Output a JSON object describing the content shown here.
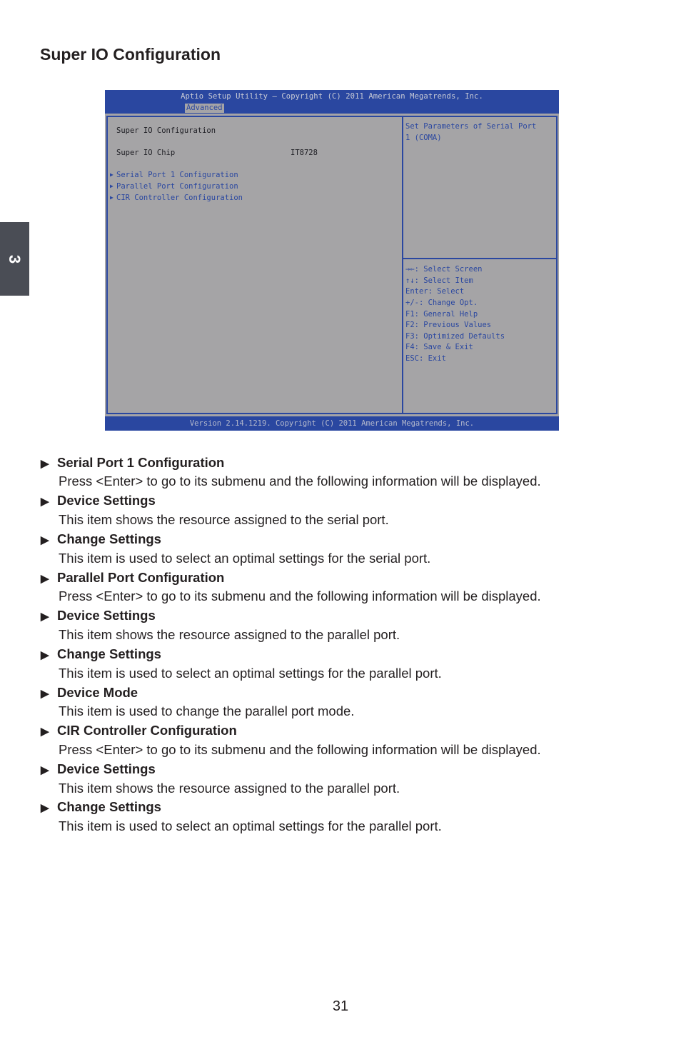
{
  "chapter_tab": "3",
  "page_title": "Super IO Configuration",
  "bios": {
    "header_title": "Aptio Setup Utility – Copyright (C) 2011 American Megatrends, Inc.",
    "active_tab": "Advanced",
    "left_panel": {
      "heading": "Super IO Configuration",
      "chip_label": "Super IO Chip",
      "chip_value": "IT8728",
      "submenus": [
        "Serial Port 1 Configuration",
        "Parallel Port Configuration",
        "CIR Controller Configuration"
      ],
      "submenu_marker": "▶"
    },
    "help_text": [
      "Set Parameters of Serial Port",
      "1 (COMA)"
    ],
    "key_help": [
      "→←: Select Screen",
      "↑↓: Select Item",
      "Enter: Select",
      "+/-: Change Opt.",
      "F1: General Help",
      "F2: Previous Values",
      "F3: Optimized Defaults",
      "F4: Save & Exit",
      "ESC: Exit"
    ],
    "footer": "Version 2.14.1219. Copyright (C) 2011 American Megatrends, Inc."
  },
  "descriptions": [
    {
      "title": "Serial Port 1 Configuration",
      "text": "Press <Enter> to go to its submenu and the following information will be displayed."
    },
    {
      "title": "Device Settings",
      "text": "This item shows the resource assigned to the serial port."
    },
    {
      "title": "Change Settings",
      "text": "This item is used to select an optimal settings for the serial port."
    },
    {
      "title": "Parallel Port Configuration",
      "text": "Press <Enter> to go to its submenu and the following information will be displayed."
    },
    {
      "title": "Device Settings",
      "text": "This item shows the resource assigned to the parallel port."
    },
    {
      "title": "Change Settings",
      "text": "This item is used to select an optimal settings for the parallel port."
    },
    {
      "title": "Device Mode",
      "text": "This item is used to change the parallel port mode."
    },
    {
      "title": "CIR Controller Configuration",
      "text": "Press <Enter> to go to its submenu and the following information will be displayed."
    },
    {
      "title": "Device Settings",
      "text": "This item shows the resource assigned to the parallel port."
    },
    {
      "title": "Change Settings",
      "text": "This item is used to select an optimal settings for the parallel port."
    }
  ],
  "bullet_glyph": "▶",
  "page_number": "31"
}
